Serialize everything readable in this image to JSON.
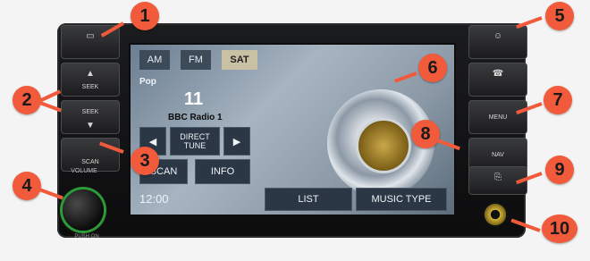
{
  "left_buttons": {
    "top": "",
    "seek_up": "SEEK",
    "seek_down": "SEEK",
    "scan": "SCAN"
  },
  "knob": {
    "label": "VOLUME",
    "sub": "PUSH ON"
  },
  "screen": {
    "tabs": [
      "AM",
      "FM",
      "SAT"
    ],
    "active_tab": "SAT",
    "category": "Pop",
    "channel_number": "11",
    "station": "BBC Radio 1",
    "direct_tune": "DIRECT TUNE",
    "scan": "SCAN",
    "info": "INFO",
    "time": "12:00",
    "list": "LIST",
    "music_type": "MUSIC TYPE"
  },
  "right_buttons": {
    "menu": "MENU",
    "nav": "NAV"
  },
  "footer": {
    "left": "",
    "center": "",
    "right": ""
  },
  "callouts": [
    "1",
    "2",
    "3",
    "4",
    "5",
    "6",
    "7",
    "8",
    "9",
    "10"
  ],
  "colors": {
    "callout": "#f15a3a",
    "active_tab": "#c9c1a3",
    "knob_ring": "#2d9b3a"
  }
}
